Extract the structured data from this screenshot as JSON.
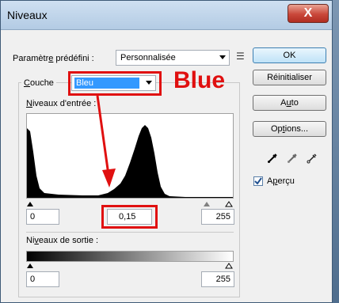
{
  "window": {
    "title": "Niveaux",
    "close_label": "X"
  },
  "preset": {
    "label_pre": "Paramètr",
    "label_u": "e",
    "label_post": " prédéfini :",
    "value": "Personnalisée"
  },
  "channel": {
    "label_u": "C",
    "label_rest": "ouche",
    "value": "Bleu",
    "annotation": "Blue"
  },
  "input_levels": {
    "label_u": "N",
    "label_rest": "iveaux d'entrée :",
    "black": "0",
    "gamma": "0,15",
    "white": "255"
  },
  "output_levels": {
    "label_pre": "Ni",
    "label_u": "v",
    "label_post": "eaux de sortie :",
    "black": "0",
    "white": "255"
  },
  "buttons": {
    "ok": "OK",
    "reset": "Réinitialiser",
    "auto_pre": "A",
    "auto_u": "u",
    "auto_post": "to",
    "options_pre": "Op",
    "options_u": "t",
    "options_post": "ions..."
  },
  "preview": {
    "label_pre": "A",
    "label_u": "p",
    "label_post": "erçu",
    "checked": true
  },
  "colors": {
    "annotation": "#e01010",
    "histogram": "#000000",
    "selected_bg": "#3399ff"
  },
  "icons": [
    "preset-menu-icon",
    "black-eyedropper-icon",
    "gray-eyedropper-icon",
    "white-eyedropper-icon"
  ]
}
